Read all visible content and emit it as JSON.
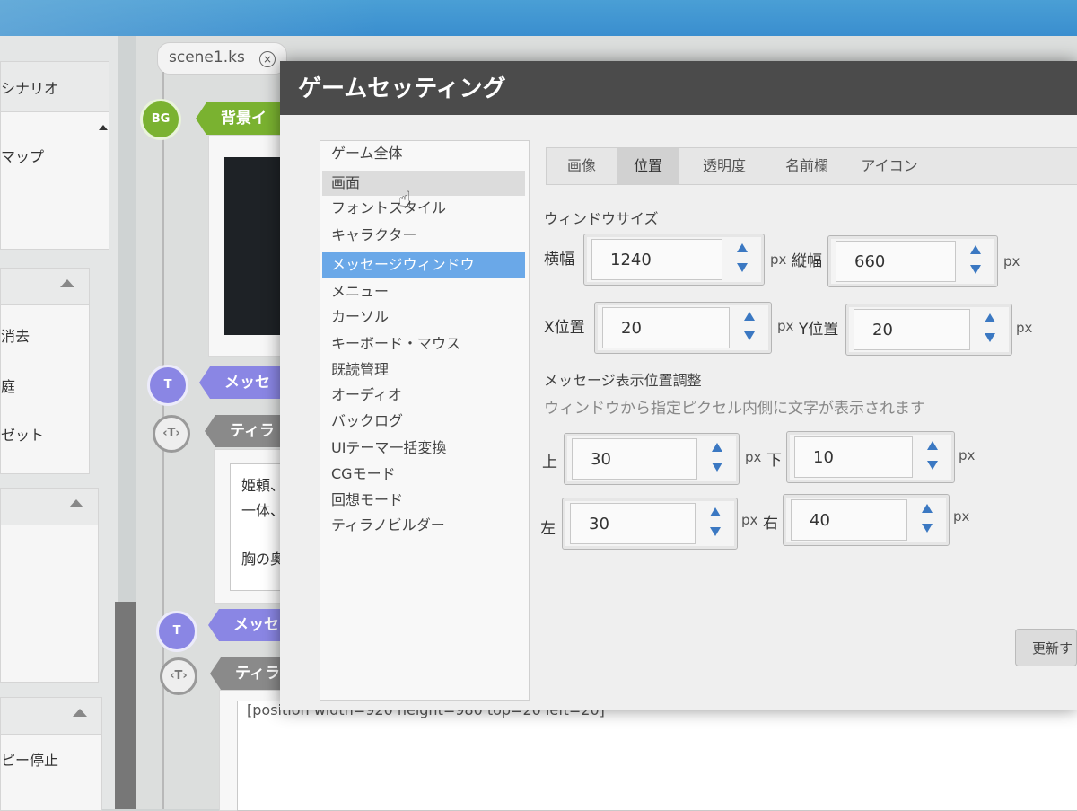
{
  "sidebar": {
    "scenario_label": "シナリオ",
    "map_label": "マップ",
    "delete_label": "消去",
    "item_label": "庭",
    "set_label": "ゼット",
    "stop_label": "ピー停止"
  },
  "editor": {
    "tab_name": "scene1.ks",
    "tab_close_glyph": "⊗",
    "node_bg_label": "背景イ",
    "node_msg_label": "メッセ",
    "node_tyrano_label": "ティラ",
    "node_msg2_label": "メッセ",
    "node_tyrano2_label": "ティラ",
    "text_line1": "姫頼、",
    "text_line2": "一体、",
    "text_line3": "胸の奥",
    "position_code": "[position width=920 height=980 top=20 left=20]"
  },
  "dialog": {
    "title": "ゲームセッティング",
    "menu": [
      {
        "label": "ゲーム全体"
      },
      {
        "label": "画面"
      },
      {
        "label": "フォントスタイル"
      },
      {
        "label": "キャラクター"
      },
      {
        "label": "メッセージウィンドウ"
      },
      {
        "label": "メニュー"
      },
      {
        "label": "カーソル"
      },
      {
        "label": "キーボード・マウス"
      },
      {
        "label": "既読管理"
      },
      {
        "label": "オーディオ"
      },
      {
        "label": "バックログ"
      },
      {
        "label": "UIテーマ一括変換"
      },
      {
        "label": "CGモード"
      },
      {
        "label": "回想モード"
      },
      {
        "label": "ティラノビルダー"
      }
    ],
    "tabs": [
      {
        "label": "画像"
      },
      {
        "label": "位置"
      },
      {
        "label": "透明度"
      },
      {
        "label": "名前欄"
      },
      {
        "label": "アイコン"
      }
    ],
    "window_size_heading": "ウィンドウサイズ",
    "width_label": "横幅",
    "width_value": "1240",
    "height_label": "縦幅",
    "height_value": "660",
    "x_label": "X位置",
    "x_value": "20",
    "y_label": "Y位置",
    "y_value": "20",
    "unit_px": "px",
    "message_pos_heading": "メッセージ表示位置調整",
    "message_pos_desc": "ウィンドウから指定ピクセル内側に文字が表示されます",
    "top_label": "上",
    "top_value": "30",
    "bottom_label": "下",
    "bottom_value": "10",
    "left_label": "左",
    "left_value": "30",
    "right_label": "右",
    "right_value": "40",
    "update_button": "更新す"
  }
}
